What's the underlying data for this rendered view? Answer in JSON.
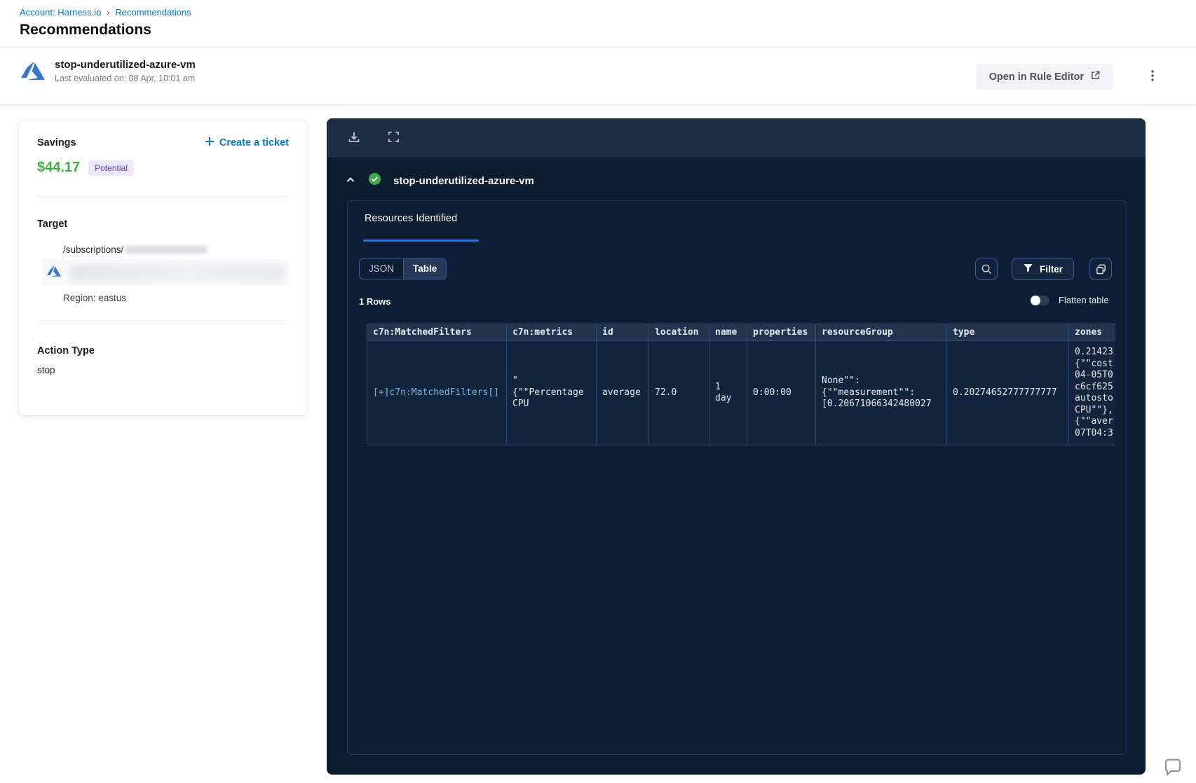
{
  "breadcrumb": {
    "account": "Account: Harness.io",
    "separator": "›",
    "current": "Recommendations"
  },
  "page": {
    "title": "Recommendations"
  },
  "header": {
    "name": "stop-underutilized-azure-vm",
    "last_evaluated": "Last evaluated on: 08 Apr, 10:01 am",
    "open_rule_editor_label": "Open in Rule Editor"
  },
  "details": {
    "savings_label": "Savings",
    "savings_amount": "$44.17",
    "savings_badge": "Potential",
    "create_ticket_label": "Create a ticket",
    "target_label": "Target",
    "target_path": "/subscriptions/",
    "region": "Region: eastus",
    "action_type_label": "Action Type",
    "action_type_value": "stop"
  },
  "panel": {
    "title": "stop-underutilized-azure-vm",
    "tab_label": "Resources Identified",
    "view_toggle": {
      "json_label": "JSON",
      "table_label": "Table",
      "active": "Table"
    },
    "filter_label": "Filter",
    "rows_count": "1 Rows",
    "flatten_label": "Flatten table"
  },
  "table": {
    "columns": [
      "c7n:MatchedFilters",
      "c7n:metrics",
      "id",
      "location",
      "name",
      "properties",
      "resourceGroup",
      "type",
      "zones"
    ],
    "rows": [
      [
        "[+]c7n:MatchedFilters[]",
        "\"\n{\"\"Percentage\nCPU",
        "average",
        "72.0",
        "1\nday",
        "0:00:00",
        "None\"\":\n{\"\"measurement\"\":\n[0.20671066342480027",
        "0.20274652777777777",
        "0.21423\n{\"\"cost\n04-05T0\nc6cf625\nautosto\nCPU\"\"},\n{\"\"aver\n07T04:3"
      ]
    ]
  },
  "icons": {
    "azure": "azure-logo",
    "download": "download",
    "fullscreen": "fullscreen",
    "search": "magnifier",
    "filter": "funnel",
    "copy": "copy",
    "kebab": "three-dot-menu",
    "check": "success-check",
    "chat": "help-bubble"
  },
  "colors": {
    "accent_blue": "#0278d5",
    "savings_green": "#42ab45",
    "badge_purple": "#6839c9",
    "success_green": "#3fae49",
    "panel_bg": "#0b1b30",
    "panel_toolbar": "#1e2d44",
    "table_header_bg": "#223450",
    "table_body_bg": "#13243d",
    "table_border": "#2d4a7a",
    "cell_link": "#79b8e0"
  }
}
